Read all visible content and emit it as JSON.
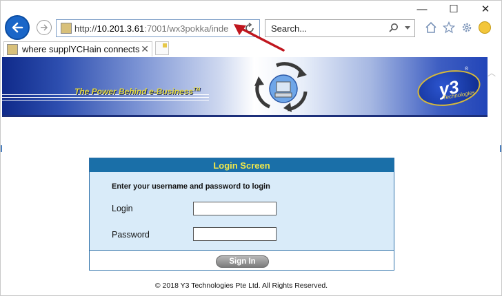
{
  "window": {
    "minimize_symbol": "—",
    "maximize_symbol": "☐",
    "close_symbol": "✕"
  },
  "address_bar": {
    "scheme": "http://",
    "host": "10.201.3.61",
    "path": ":7001/wx3pokka/inde"
  },
  "search": {
    "placeholder": "Search..."
  },
  "tab": {
    "title": "where supplYCHain connects",
    "close_symbol": "✕"
  },
  "banner": {
    "tagline": "The Power Behind e-Business",
    "tagline_mark": "TM",
    "logo_text": "y3",
    "logo_subtext": "Technologies",
    "logo_reg": "®"
  },
  "login": {
    "header": "Login Screen",
    "instruction": "Enter your username and password to login",
    "login_label": "Login",
    "password_label": "Password",
    "login_value": "",
    "password_value": "",
    "signin_label": "Sign In"
  },
  "footer": {
    "copyright": "© 2018 Y3 Technologies Pte Ltd. All Rights Reserved."
  },
  "colors": {
    "login_header_bg": "#1a6fa8",
    "login_header_text": "#f1e84a",
    "login_body_bg": "#d9ebf9",
    "back_button": "#1a66c8",
    "annotation_arrow": "#c0161e"
  }
}
